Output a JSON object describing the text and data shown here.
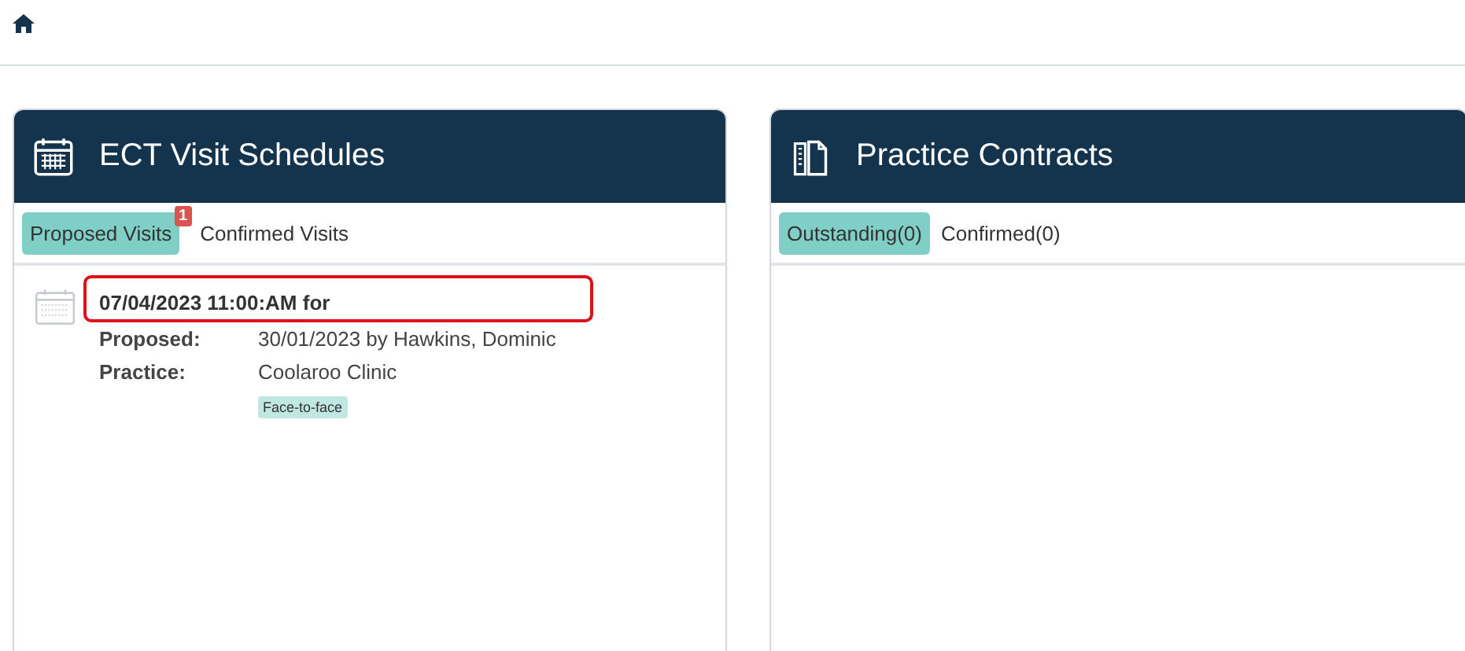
{
  "panels": [
    {
      "title": "ECT Visit Schedules",
      "tabs": [
        {
          "label": "Proposed Visits",
          "selected": true,
          "badge": "1"
        },
        {
          "label": "Confirmed Visits",
          "selected": false
        }
      ],
      "items": [
        {
          "datetime": "07/04/2023 11:00:AM for",
          "highlighted": true,
          "fields": [
            {
              "label": "Proposed:",
              "value": "30/01/2023 by Hawkins, Dominic"
            },
            {
              "label": "Practice:",
              "value": "Coolaroo Clinic"
            }
          ],
          "tag": "Face-to-face"
        }
      ]
    },
    {
      "title": "Practice Contracts",
      "tabs": [
        {
          "label": "Outstanding(0)",
          "selected": true
        },
        {
          "label": "Confirmed(0)",
          "selected": false
        }
      ]
    }
  ]
}
